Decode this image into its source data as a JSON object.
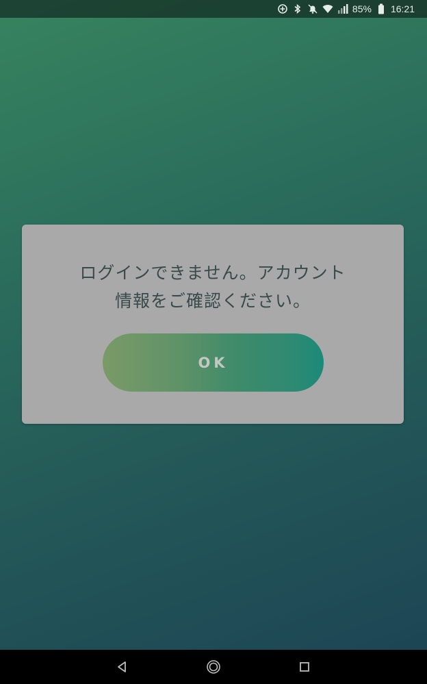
{
  "status_bar": {
    "battery_percent": "85%",
    "time": "16:21",
    "icons": [
      "data-saver-icon",
      "bluetooth-icon",
      "alarm-off-icon",
      "wifi-icon",
      "signal-icon",
      "battery-icon"
    ]
  },
  "dialog": {
    "message_line1": "ログインできません。アカウント",
    "message_line2": "情報をご確認ください。",
    "ok_label": "OK"
  },
  "nav_bar": {
    "icons": [
      "back-icon",
      "home-icon",
      "recents-icon"
    ]
  },
  "colors": {
    "background_top": "#37845f",
    "background_bottom": "#1c4354",
    "dialog_bg": "#a9a9a9",
    "button_start": "#7a9a68",
    "button_end": "#1b8a78"
  }
}
